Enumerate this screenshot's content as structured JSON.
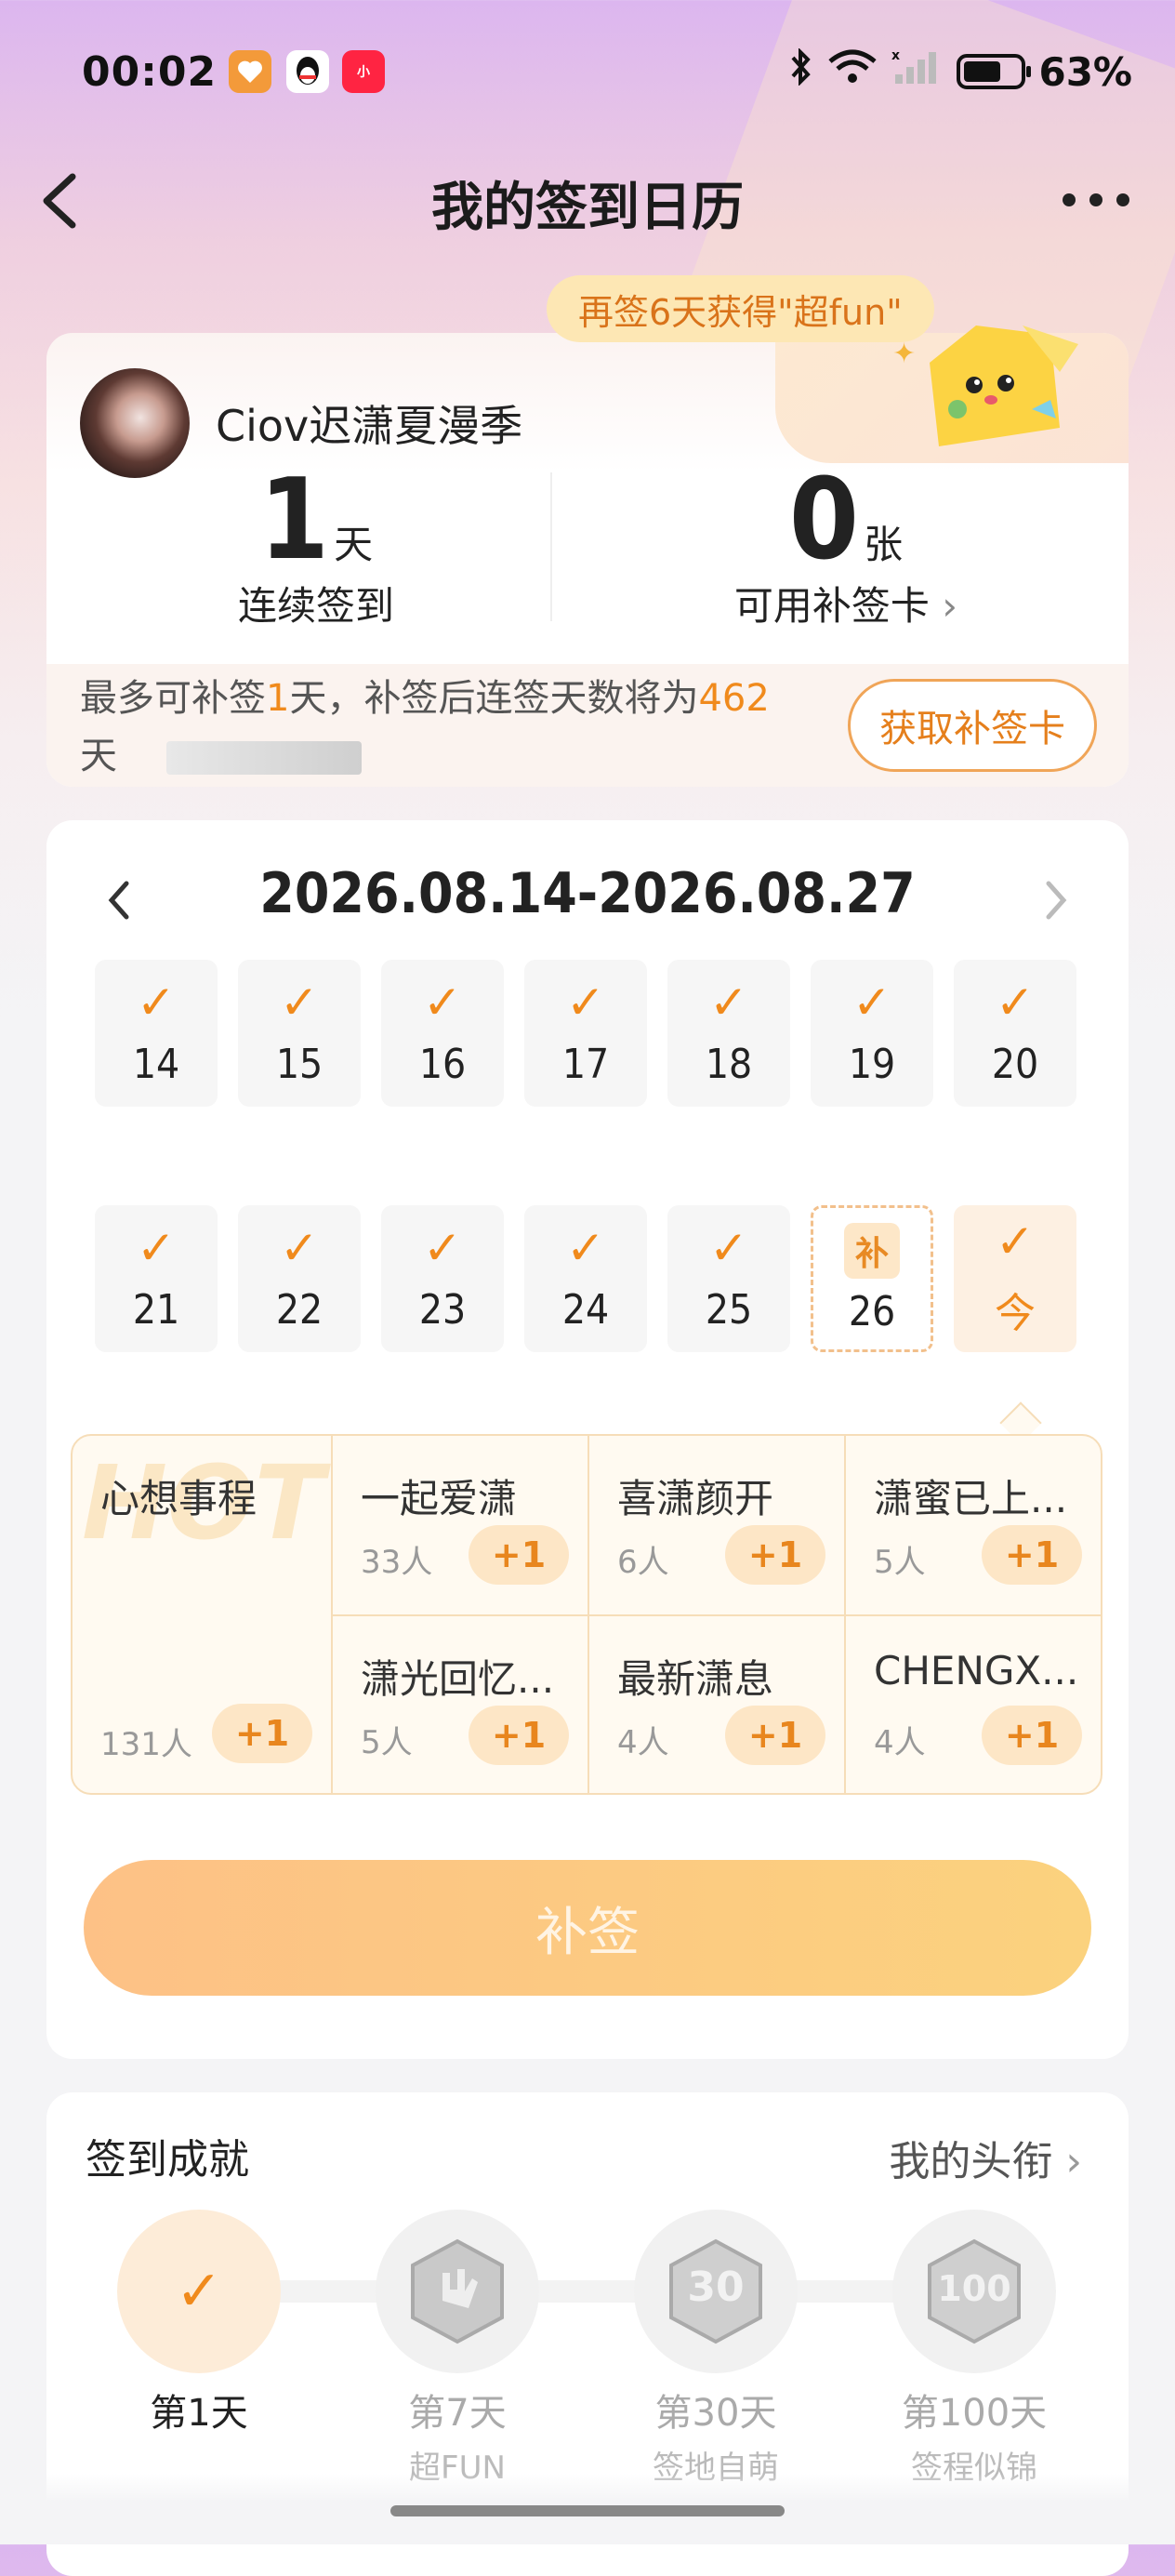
{
  "status_bar": {
    "time": "00:02",
    "battery": "63%"
  },
  "nav": {
    "title": "我的签到日历"
  },
  "promo": {
    "tooltip": "再签6天获得\"超fun\""
  },
  "profile": {
    "username": "Ciov迟潇夏漫季",
    "streak_value": "1",
    "streak_unit": "天",
    "streak_label": "连续签到",
    "cards_value": "0",
    "cards_unit": "张",
    "cards_label": "可用补签卡"
  },
  "makeup_info": {
    "prefix": "最多可补签",
    "days": "1",
    "middle": "天，补签后连签天数将为",
    "total": "462",
    "suffix": "天",
    "get_card_button": "获取补签卡"
  },
  "calendar": {
    "range": "2026.08.14-2026.08.27",
    "row1": [
      "14",
      "15",
      "16",
      "17",
      "18",
      "19",
      "20"
    ],
    "row2": [
      "21",
      "22",
      "23",
      "24",
      "25"
    ],
    "makeup_day": {
      "tag": "补",
      "date": "26"
    },
    "today_label": "今"
  },
  "groups": {
    "featured": {
      "name": "心想事程",
      "count": "131人",
      "plus": "+1"
    },
    "items": [
      {
        "name": "一起爱潇",
        "count": "33人",
        "plus": "+1"
      },
      {
        "name": "喜潇颜开",
        "count": "6人",
        "plus": "+1"
      },
      {
        "name": "潇蜜已上...",
        "count": "5人",
        "plus": "+1"
      },
      {
        "name": "潇光回忆...",
        "count": "5人",
        "plus": "+1"
      },
      {
        "name": "最新潇息",
        "count": "4人",
        "plus": "+1"
      },
      {
        "name": "CHENGX...",
        "count": "4人",
        "plus": "+1"
      }
    ]
  },
  "makeup_button": "补签",
  "achievements": {
    "title": "签到成就",
    "link": "我的头衔",
    "items": [
      {
        "day": "第1天",
        "badge": ""
      },
      {
        "day": "第7天",
        "badge": "超FUN"
      },
      {
        "day": "第30天",
        "badge": "签地自萌"
      },
      {
        "day": "第100天",
        "badge": "签程似锦"
      }
    ]
  },
  "colors": {
    "accent": "#f08a1c",
    "button_gradient_start": "#fdc186",
    "button_gradient_end": "#fbd27e"
  },
  "icons": [
    "back-chevron-icon",
    "more-icon",
    "bluetooth-icon",
    "wifi-icon",
    "signal-icon",
    "battery-icon",
    "checkmark-icon",
    "chevron-right-icon"
  ]
}
